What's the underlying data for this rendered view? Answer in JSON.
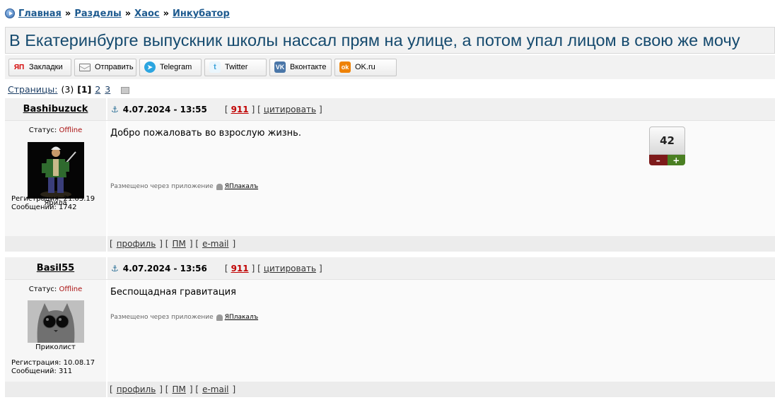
{
  "breadcrumb": {
    "items": [
      "Главная",
      "Разделы",
      "Хаос",
      "Инкубатор"
    ],
    "separator": "»"
  },
  "title": "В Екатеринбурге выпускник школы нассал прям на улице, а потом упал лицом в свою же мочу",
  "share": [
    {
      "icon": "yaplakal-icon",
      "label": "Закладки"
    },
    {
      "icon": "mail-icon",
      "label": "Отправить"
    },
    {
      "icon": "telegram-icon",
      "label": "Telegram"
    },
    {
      "icon": "twitter-icon",
      "label": "Twitter"
    },
    {
      "icon": "vk-icon",
      "label": "Вконтакте"
    },
    {
      "icon": "ok-icon",
      "label": "OK.ru"
    }
  ],
  "pages": {
    "label": "Страницы:",
    "total": "(3)",
    "current": "[1]",
    "others": [
      "2",
      "3"
    ]
  },
  "posts": [
    {
      "author": "Bashibuzuck",
      "date": "4.07.2024 - 13:55",
      "number": "911",
      "quote": "цитировать",
      "status_label": "Статус:",
      "status": "Offline",
      "rank": "Ярила",
      "registration": "Регистрация: 21.03.19",
      "messages": "Сообщений: 1742",
      "text": "Добро пожаловать во взрослую жизнь.",
      "via_label": "Размещено через приложение",
      "via_app": "ЯПлакалъ",
      "rating": "42",
      "minus": "–",
      "plus": "+"
    },
    {
      "author": "Basil55",
      "date": "4.07.2024 - 13:56",
      "number": "911",
      "quote": "цитировать",
      "status_label": "Статус:",
      "status": "Offline",
      "rank": "Приколист",
      "registration": "Регистрация: 10.08.17",
      "messages": "Сообщений: 311",
      "text": "Беспощадная гравитация",
      "via_label": "Размещено через приложение",
      "via_app": "ЯПлакалъ"
    }
  ],
  "footer_links": [
    "профиль",
    "ПМ",
    "e-mail"
  ],
  "share_icons_text": {
    "yaplakal": "ЯП",
    "telegram": "➤",
    "twitter": "t",
    "vk": "VK",
    "ok": "ok"
  }
}
